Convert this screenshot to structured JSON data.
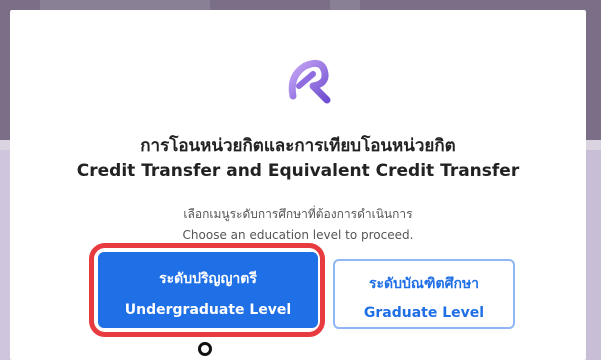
{
  "modal": {
    "title_th": "การโอนหน่วยกิตและการเทียบโอนหน่วยกิต",
    "title_en": "Credit Transfer and Equivalent Credit Transfer",
    "subtitle_th": "เลือกเมนูระดับการศึกษาที่ต้องการดำเนินการ",
    "subtitle_en": "Choose an education level to proceed."
  },
  "buttons": {
    "undergraduate": {
      "label_th": "ระดับปริญญาตรี",
      "label_en": "Undergraduate Level"
    },
    "graduate": {
      "label_th": "ระดับบัณฑิตศึกษา",
      "label_en": "Graduate Level"
    }
  },
  "colors": {
    "primary": "#1f6fe6",
    "highlight": "#e73b3f",
    "logo_gradient": [
      "#b48cf0",
      "#7b5bd6"
    ]
  },
  "icons": {
    "logo": "brand-logo-icon",
    "cursor": "cursor-ring-icon"
  }
}
